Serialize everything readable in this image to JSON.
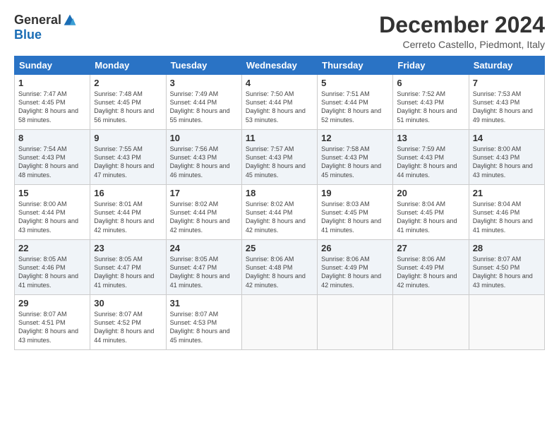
{
  "logo": {
    "general": "General",
    "blue": "Blue"
  },
  "title": "December 2024",
  "location": "Cerreto Castello, Piedmont, Italy",
  "days_header": [
    "Sunday",
    "Monday",
    "Tuesday",
    "Wednesday",
    "Thursday",
    "Friday",
    "Saturday"
  ],
  "weeks": [
    [
      {
        "day": "1",
        "sunrise": "7:47 AM",
        "sunset": "4:45 PM",
        "daylight": "8 hours and 58 minutes."
      },
      {
        "day": "2",
        "sunrise": "7:48 AM",
        "sunset": "4:45 PM",
        "daylight": "8 hours and 56 minutes."
      },
      {
        "day": "3",
        "sunrise": "7:49 AM",
        "sunset": "4:44 PM",
        "daylight": "8 hours and 55 minutes."
      },
      {
        "day": "4",
        "sunrise": "7:50 AM",
        "sunset": "4:44 PM",
        "daylight": "8 hours and 53 minutes."
      },
      {
        "day": "5",
        "sunrise": "7:51 AM",
        "sunset": "4:44 PM",
        "daylight": "8 hours and 52 minutes."
      },
      {
        "day": "6",
        "sunrise": "7:52 AM",
        "sunset": "4:43 PM",
        "daylight": "8 hours and 51 minutes."
      },
      {
        "day": "7",
        "sunrise": "7:53 AM",
        "sunset": "4:43 PM",
        "daylight": "8 hours and 49 minutes."
      }
    ],
    [
      {
        "day": "8",
        "sunrise": "7:54 AM",
        "sunset": "4:43 PM",
        "daylight": "8 hours and 48 minutes."
      },
      {
        "day": "9",
        "sunrise": "7:55 AM",
        "sunset": "4:43 PM",
        "daylight": "8 hours and 47 minutes."
      },
      {
        "day": "10",
        "sunrise": "7:56 AM",
        "sunset": "4:43 PM",
        "daylight": "8 hours and 46 minutes."
      },
      {
        "day": "11",
        "sunrise": "7:57 AM",
        "sunset": "4:43 PM",
        "daylight": "8 hours and 45 minutes."
      },
      {
        "day": "12",
        "sunrise": "7:58 AM",
        "sunset": "4:43 PM",
        "daylight": "8 hours and 45 minutes."
      },
      {
        "day": "13",
        "sunrise": "7:59 AM",
        "sunset": "4:43 PM",
        "daylight": "8 hours and 44 minutes."
      },
      {
        "day": "14",
        "sunrise": "8:00 AM",
        "sunset": "4:43 PM",
        "daylight": "8 hours and 43 minutes."
      }
    ],
    [
      {
        "day": "15",
        "sunrise": "8:00 AM",
        "sunset": "4:44 PM",
        "daylight": "8 hours and 43 minutes."
      },
      {
        "day": "16",
        "sunrise": "8:01 AM",
        "sunset": "4:44 PM",
        "daylight": "8 hours and 42 minutes."
      },
      {
        "day": "17",
        "sunrise": "8:02 AM",
        "sunset": "4:44 PM",
        "daylight": "8 hours and 42 minutes."
      },
      {
        "day": "18",
        "sunrise": "8:02 AM",
        "sunset": "4:44 PM",
        "daylight": "8 hours and 42 minutes."
      },
      {
        "day": "19",
        "sunrise": "8:03 AM",
        "sunset": "4:45 PM",
        "daylight": "8 hours and 41 minutes."
      },
      {
        "day": "20",
        "sunrise": "8:04 AM",
        "sunset": "4:45 PM",
        "daylight": "8 hours and 41 minutes."
      },
      {
        "day": "21",
        "sunrise": "8:04 AM",
        "sunset": "4:46 PM",
        "daylight": "8 hours and 41 minutes."
      }
    ],
    [
      {
        "day": "22",
        "sunrise": "8:05 AM",
        "sunset": "4:46 PM",
        "daylight": "8 hours and 41 minutes."
      },
      {
        "day": "23",
        "sunrise": "8:05 AM",
        "sunset": "4:47 PM",
        "daylight": "8 hours and 41 minutes."
      },
      {
        "day": "24",
        "sunrise": "8:05 AM",
        "sunset": "4:47 PM",
        "daylight": "8 hours and 41 minutes."
      },
      {
        "day": "25",
        "sunrise": "8:06 AM",
        "sunset": "4:48 PM",
        "daylight": "8 hours and 42 minutes."
      },
      {
        "day": "26",
        "sunrise": "8:06 AM",
        "sunset": "4:49 PM",
        "daylight": "8 hours and 42 minutes."
      },
      {
        "day": "27",
        "sunrise": "8:06 AM",
        "sunset": "4:49 PM",
        "daylight": "8 hours and 42 minutes."
      },
      {
        "day": "28",
        "sunrise": "8:07 AM",
        "sunset": "4:50 PM",
        "daylight": "8 hours and 43 minutes."
      }
    ],
    [
      {
        "day": "29",
        "sunrise": "8:07 AM",
        "sunset": "4:51 PM",
        "daylight": "8 hours and 43 minutes."
      },
      {
        "day": "30",
        "sunrise": "8:07 AM",
        "sunset": "4:52 PM",
        "daylight": "8 hours and 44 minutes."
      },
      {
        "day": "31",
        "sunrise": "8:07 AM",
        "sunset": "4:53 PM",
        "daylight": "8 hours and 45 minutes."
      },
      null,
      null,
      null,
      null
    ]
  ]
}
